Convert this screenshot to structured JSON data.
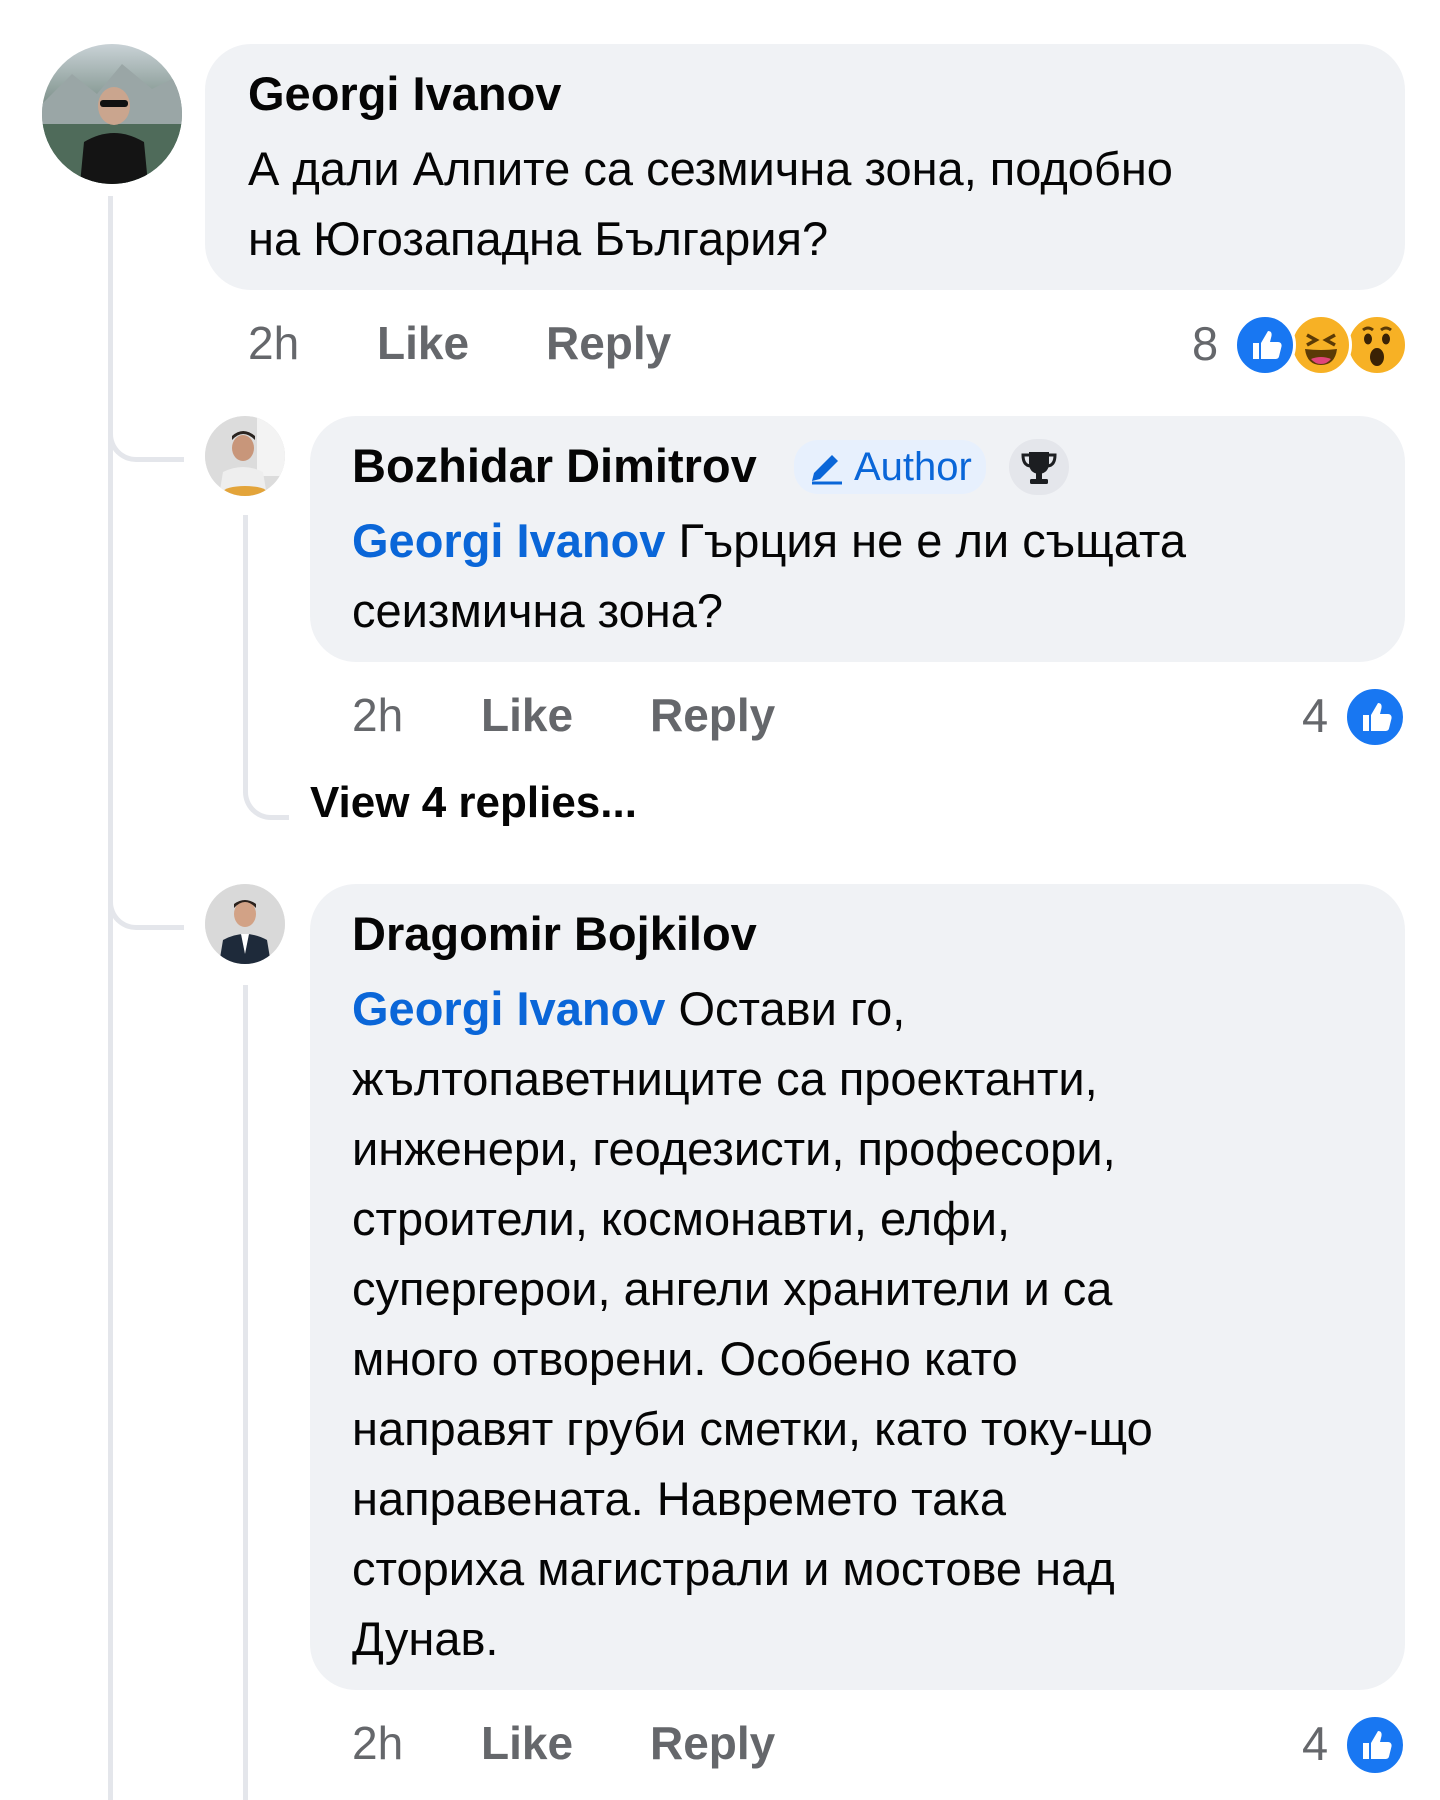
{
  "comments": [
    {
      "author": "Georgi Ivanov",
      "text_line1": "А дали Алпите са сезмична зона, подобно",
      "text_line2": "на Югозападна България?",
      "time": "2h",
      "like_label": "Like",
      "reply_label": "Reply",
      "reaction_count": "8",
      "reactions": [
        "like-icon",
        "haha-icon",
        "wow-icon"
      ]
    },
    {
      "author": "Bozhidar Dimitrov",
      "badge_author": "Author",
      "badge_icon": "trophy-icon",
      "mention": "Georgi Ivanov",
      "text_line1": " Гърция не е ли същата",
      "text_line2": "сеизмична зона?",
      "time": "2h",
      "like_label": "Like",
      "reply_label": "Reply",
      "reaction_count": "4",
      "reactions": [
        "like-icon"
      ],
      "view_replies": "View 4 replies..."
    },
    {
      "author": "Dragomir Bojkilov",
      "mention": "Georgi Ivanov",
      "lines": [
        " Остави го,",
        "жълтопаветниците са проектанти,",
        "инженери, геодезисти, професори,",
        "строители, космонавти, елфи,",
        "супергерои, ангели хранители и са",
        "много отворени. Особено като",
        "направят груби сметки, като току-що",
        "направената. Навремето така",
        "сториха магистрали и мостове над",
        "Дунав."
      ],
      "time": "2h",
      "like_label": "Like",
      "reply_label": "Reply",
      "reaction_count": "4",
      "reactions": [
        "like-icon"
      ]
    }
  ],
  "colors": {
    "bubble": "#f0f2f5",
    "mention": "#0a66d8",
    "meta": "#65676b",
    "like_blue": "#1877f2",
    "thread_line": "#e4e6eb"
  }
}
